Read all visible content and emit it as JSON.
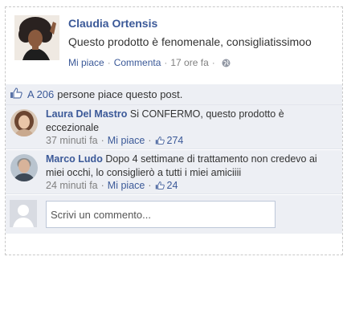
{
  "post": {
    "author": "Claudia Ortensis",
    "text": "Questo prodotto è fenomenale, consigliatissimoo",
    "like_label": "Mi piace",
    "comment_label": "Commenta",
    "time": "17 ore fa",
    "privacy_icon": "globe-icon"
  },
  "likes": {
    "count_text": "A 206",
    "rest_text": "persone piace questo post."
  },
  "comments": [
    {
      "name": "Laura Del Mastro",
      "text": "Si CONFERMO, questo prodotto è eccezionale",
      "time": "37 minuti fa",
      "like_label": "Mi piace",
      "likes": "274"
    },
    {
      "name": "Marco Ludo",
      "text": "Dopo 4 settimane di trattamento non credevo ai miei occhi, lo consiglierò a tutti i miei amiciiii",
      "time": "24 minuti fa",
      "like_label": "Mi piace",
      "likes": "24"
    }
  ],
  "write": {
    "placeholder": "Scrivi un commento..."
  },
  "colors": {
    "link": "#3b5998",
    "panel": "#edeff4",
    "meta": "#808080"
  }
}
